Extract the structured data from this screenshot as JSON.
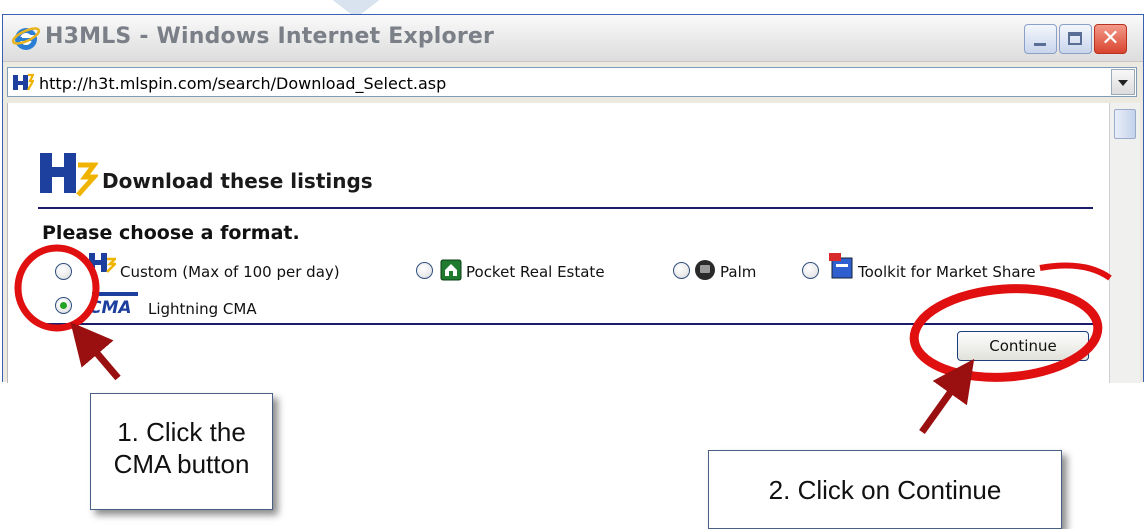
{
  "window": {
    "title": "H3MLS - Windows Internet Explorer",
    "url": "http://h3t.mlspin.com/search/Download_Select.asp"
  },
  "page": {
    "heading": "Download these listings",
    "prompt": "Please choose a format.",
    "options": [
      {
        "label": "Custom (Max of 100 per day)",
        "selected": false
      },
      {
        "label": "Pocket Real Estate",
        "selected": false
      },
      {
        "label": "Palm",
        "selected": false
      },
      {
        "label": "Toolkit for Market Share",
        "selected": false
      },
      {
        "label": "Lightning CMA",
        "selected": true
      }
    ],
    "continue_label": "Continue"
  },
  "callouts": {
    "step1": "1. Click the CMA button",
    "step2": "2. Click on Continue"
  },
  "colors": {
    "annotation_red": "#e01010",
    "arrow_red": "#9a1010",
    "rule_navy": "#1b1d6b",
    "selected_radio": "#22a422"
  },
  "icons": {
    "browser": "internet-explorer-icon",
    "site": "h3-logo-icon",
    "pocket": "pocket-real-estate-icon",
    "palm": "palm-icon",
    "toolkit": "toolkit-icon",
    "cma": "lightning-cma-icon"
  }
}
